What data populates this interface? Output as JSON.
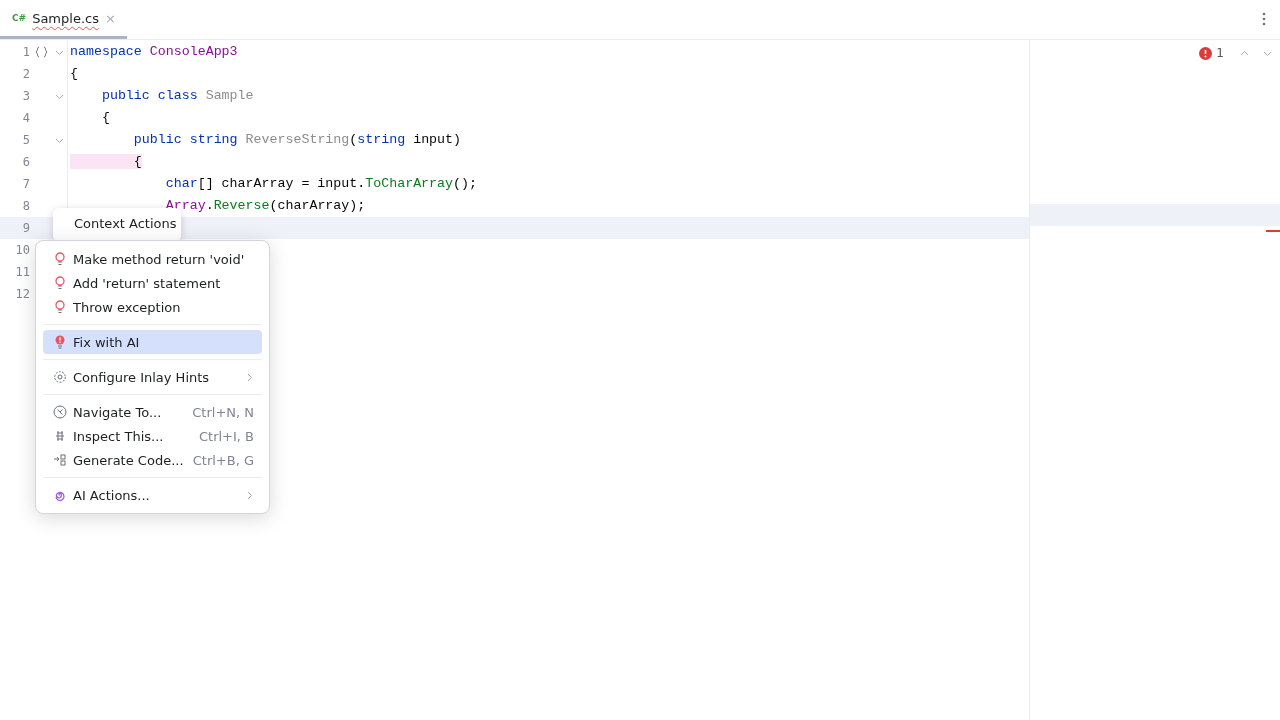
{
  "tab": {
    "lang": "C#",
    "title": "Sample.cs",
    "close": "×",
    "selected": true
  },
  "inspection": {
    "count": "1"
  },
  "lines": [
    {
      "number": "1",
      "fold": true,
      "structure_marker": true,
      "current": false,
      "tokens": [
        {
          "kind": "keyword",
          "text": "namespace "
        },
        {
          "kind": "namespace",
          "text": "ConsoleApp3"
        }
      ]
    },
    {
      "number": "2",
      "fold": false,
      "current": false,
      "tokens": [
        {
          "kind": "plain",
          "text": "{"
        }
      ]
    },
    {
      "number": "3",
      "fold": true,
      "current": false,
      "tokens": [
        {
          "kind": "keyword",
          "text": "    public class "
        },
        {
          "kind": "unused",
          "text": "Sample"
        }
      ]
    },
    {
      "number": "4",
      "fold": false,
      "current": false,
      "tokens": [
        {
          "kind": "plain",
          "text": "    {"
        }
      ]
    },
    {
      "number": "5",
      "fold": true,
      "current": false,
      "tokens": [
        {
          "kind": "keyword",
          "text": "        public string "
        },
        {
          "kind": "unused",
          "text": "ReverseString"
        },
        {
          "kind": "plain",
          "text": "("
        },
        {
          "kind": "keyword",
          "text": "string"
        },
        {
          "kind": "plain",
          "text": " input)"
        }
      ]
    },
    {
      "number": "6",
      "fold": false,
      "current": false,
      "tokens": [
        {
          "kind": "brace-match",
          "text": "        {"
        }
      ]
    },
    {
      "number": "7",
      "fold": false,
      "current": false,
      "tokens": [
        {
          "kind": "keyword",
          "text": "            char"
        },
        {
          "kind": "plain",
          "text": "[] charArray = input."
        },
        {
          "kind": "call",
          "text": "ToCharArray"
        },
        {
          "kind": "plain",
          "text": "();"
        }
      ]
    },
    {
      "number": "8",
      "fold": false,
      "current": false,
      "tokens": [
        {
          "kind": "namespace",
          "text": "            Array"
        },
        {
          "kind": "plain",
          "text": "."
        },
        {
          "kind": "call",
          "text": "Reverse"
        },
        {
          "kind": "plain",
          "text": "(charArray);"
        }
      ]
    },
    {
      "number": "9",
      "current": true
    },
    {
      "number": "10",
      "current": false
    },
    {
      "number": "11",
      "current": false
    },
    {
      "number": "12",
      "current": false
    }
  ],
  "tooltip": {
    "title": "Context Actions"
  },
  "menu": {
    "groups": [
      [
        {
          "kind": "quick-fix",
          "label": "Make method return 'void'",
          "selected": false,
          "submenu": false
        },
        {
          "kind": "quick-fix",
          "label": "Add 'return' statement",
          "selected": false,
          "submenu": false
        },
        {
          "kind": "quick-fix",
          "label": "Throw exception",
          "selected": false,
          "submenu": false
        }
      ],
      [
        {
          "kind": "ai-fix",
          "label": "Fix with AI",
          "selected": true,
          "submenu": false
        }
      ],
      [
        {
          "kind": "settings",
          "label": "Configure Inlay Hints",
          "selected": false,
          "submenu": true
        }
      ],
      [
        {
          "kind": "navigate",
          "label": "Navigate To...",
          "shortcut": "Ctrl+N, N",
          "selected": false,
          "submenu": false
        },
        {
          "kind": "inspect",
          "label": "Inspect This...",
          "shortcut": "Ctrl+I, B",
          "selected": false,
          "submenu": false
        },
        {
          "kind": "generate",
          "label": "Generate Code...",
          "shortcut": "Ctrl+B, G",
          "selected": false,
          "submenu": false
        }
      ],
      [
        {
          "kind": "ai",
          "label": "AI Actions...",
          "selected": false,
          "submenu": true
        }
      ]
    ]
  }
}
